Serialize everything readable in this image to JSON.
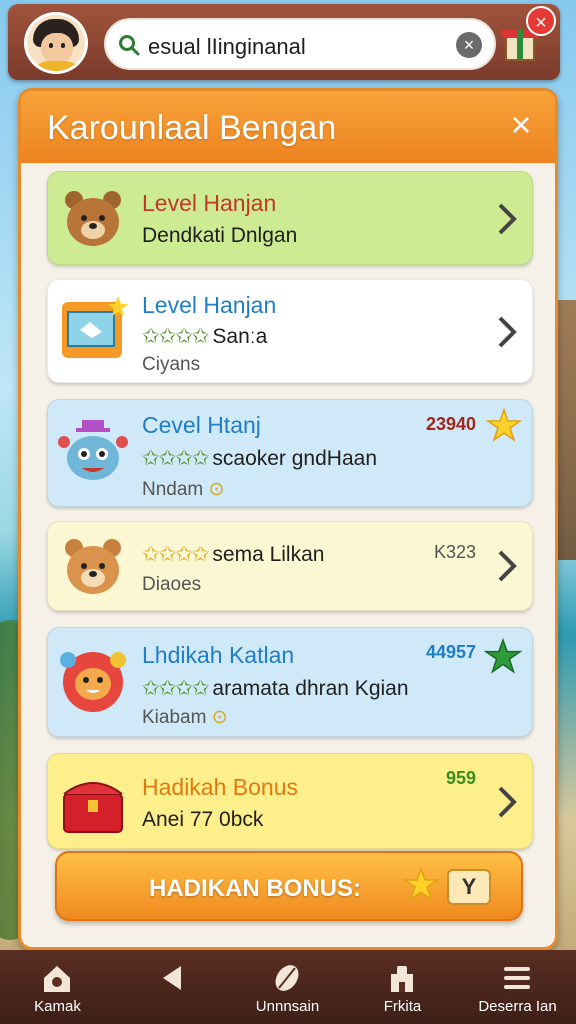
{
  "topbar": {
    "search_text": "esual lIinginanal",
    "clear_icon": "×",
    "close_icon": "×"
  },
  "panel": {
    "title": "Karounlaal Bengan",
    "close_icon": "×"
  },
  "cards": [
    {
      "title": "Level Hanjan",
      "subtitle": "Dendkati Dnlgan",
      "color": "#cdeb93",
      "title_color": "#c0392b"
    },
    {
      "title": "Level Hanjan",
      "stars": "✩✩✩✩",
      "subtitle": "Sanːa",
      "detail": "Ciyans",
      "color": "#ffffff",
      "title_color": "#1f7ec4"
    },
    {
      "title": "Cevel Htanj",
      "value": "23940",
      "stars": "✩✩✩✩",
      "subtitle": "scaoker gndHaan",
      "detail": "Nndam",
      "color": "#cfe9f8",
      "title_color": "#1f7ec4",
      "value_color": "#a0281c"
    },
    {
      "stars": "✩✩✩✩",
      "subtitle": "sema Lilkan",
      "value": "K323",
      "detail": "Diaoes",
      "color": "#fbf7d2"
    },
    {
      "title": "Lhdikah Katlan",
      "value": "44957",
      "stars": "✩✩✩✩",
      "subtitle": "aramata dhran Kgian",
      "detail": "Kiabam",
      "color": "#cfe9f8",
      "title_color": "#1f7ec4",
      "value_color": "#1f7ec4"
    },
    {
      "title": "Hadikah Bonus",
      "value": "959",
      "subtitle": "Anei 77 0bck",
      "color": "#fcef8c",
      "title_color": "#e07a10",
      "value_color": "#3a8d1e"
    }
  ],
  "bonus_button": {
    "label": "HADIKAN BONUS:",
    "ticket": "Y"
  },
  "bottom_nav": [
    {
      "label": "Kamak",
      "icon": "home-gear-icon"
    },
    {
      "label": "",
      "icon": "back-triangle-icon"
    },
    {
      "label": "Unnnsain",
      "icon": "leaf-icon"
    },
    {
      "label": "Frkita",
      "icon": "shop-icon"
    },
    {
      "label": "Deserra Ian",
      "icon": "menu-icon"
    }
  ]
}
